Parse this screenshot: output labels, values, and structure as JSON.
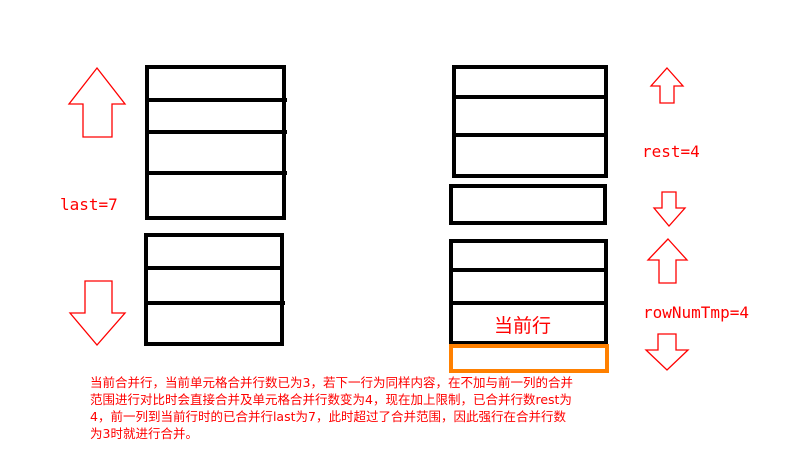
{
  "labels": {
    "last": "last=7",
    "rest": "rest=4",
    "rownum_tmp": "rowNumTmp=4",
    "current_row": "当前行"
  },
  "explanation": {
    "lines": [
      "当前合并行，当前单元格合并行数已为3，若下一行为同样内容，在不加与前一列的合并",
      "范围进行对比时会直接合并及单元格合并行数变为4，现在加上限制，已合并行数rest为",
      "4，前一列到当前行时的已合并行last为7，此时超过了合并范围，因此强行在合并行数",
      "为3时就进行合并。"
    ]
  },
  "colors": {
    "cell_border": "#000000",
    "arrow": "#ff0000",
    "text": "#ff0000",
    "highlight": "#ff8000"
  }
}
